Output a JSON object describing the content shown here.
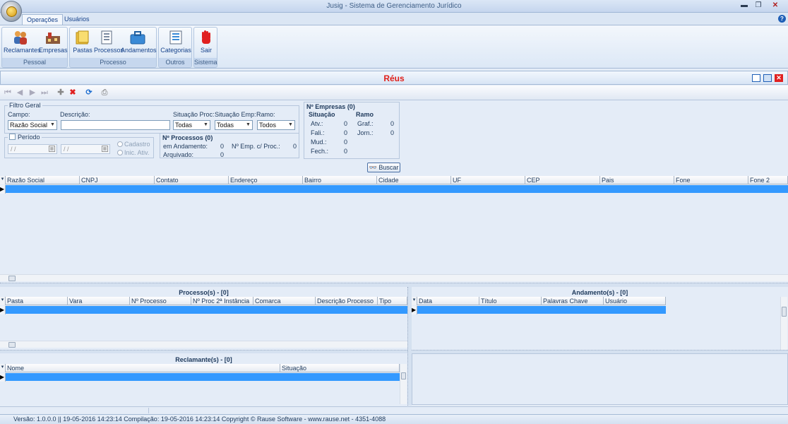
{
  "window": {
    "title": "Jusig - Sistema de Gerenciamento Jurídico"
  },
  "ribbon": {
    "tabs": [
      {
        "label": "Operações",
        "active": true
      },
      {
        "label": "Usuários",
        "active": false
      }
    ],
    "groups": [
      {
        "label": "Pessoal",
        "buttons": [
          "Reclamantes",
          "Empresas"
        ]
      },
      {
        "label": "Processo",
        "buttons": [
          "Pastas",
          "Processos",
          "Andamentos"
        ]
      },
      {
        "label": "Outros",
        "buttons": [
          "Categorias"
        ]
      },
      {
        "label": "Sistema",
        "buttons": [
          "Sair"
        ]
      }
    ]
  },
  "form": {
    "title": "Réus"
  },
  "filter": {
    "legend": "Filtro Geral",
    "campo_label": "Campo:",
    "campo_value": "Razão Social",
    "descricao_label": "Descrição:",
    "descricao_value": "",
    "sit_proc_label": "Situação Proc:",
    "sit_proc_value": "Todas",
    "sit_emp_label": "Situação Emp:",
    "sit_emp_value": "Todas",
    "ramo_label": "Ramo:",
    "ramo_value": "Todos"
  },
  "periodo": {
    "label": "Período",
    "date1": "/ /",
    "date2": "/ /",
    "radio1": "Cadastro",
    "radio2": "Inic. Ativ."
  },
  "nprocessos": {
    "title": "Nº Processos (0)",
    "em_andamento_label": "em Andamento:",
    "em_andamento_value": "0",
    "arquivado_label": "Arquivado:",
    "arquivado_value": "0",
    "emp_proc_label": "Nº Emp. c/ Proc.:",
    "emp_proc_value": "0"
  },
  "nempresas": {
    "title": "Nº Empresas (0)",
    "situacao_header": "Situação",
    "ramo_header": "Ramo",
    "situacao": [
      {
        "label": "Atv.:",
        "value": "0"
      },
      {
        "label": "Fali.:",
        "value": "0"
      },
      {
        "label": "Mud.:",
        "value": "0"
      },
      {
        "label": "Fech.:",
        "value": "0"
      }
    ],
    "ramo": [
      {
        "label": "Graf.:",
        "value": "0"
      },
      {
        "label": "Jorn.:",
        "value": "0"
      }
    ]
  },
  "buscar_label": "Buscar",
  "main_grid": {
    "columns": [
      "Razão Social",
      "CNPJ",
      "Contato",
      "Endereço",
      "Bairro",
      "Cidade",
      "UF",
      "CEP",
      "Pais",
      "Fone",
      "Fone 2"
    ]
  },
  "processos": {
    "title": "Processo(s) - [0]",
    "columns": [
      "Pasta",
      "Vara",
      "Nº Processo",
      "Nº Proc 2ª Instância",
      "Comarca",
      "Descrição Processo",
      "Tipo"
    ]
  },
  "andamentos": {
    "title": "Andamento(s) - [0]",
    "columns": [
      "Data",
      "Título",
      "Palavras Chave",
      "Usuário"
    ]
  },
  "reclamantes": {
    "title": "Reclamante(s) - [0]",
    "columns": [
      "Nome",
      "Situação"
    ]
  },
  "statusbar": {
    "text": "Versão: 1.0.0.0 || 19-05-2016 14:23:14   Compilação: 19-05-2016 14:23:14   Copyright © Rause Software  -  www.rause.net  -  4351-4088"
  },
  "colors": {
    "accent": "#3399ff",
    "title_red": "#e0201a"
  }
}
